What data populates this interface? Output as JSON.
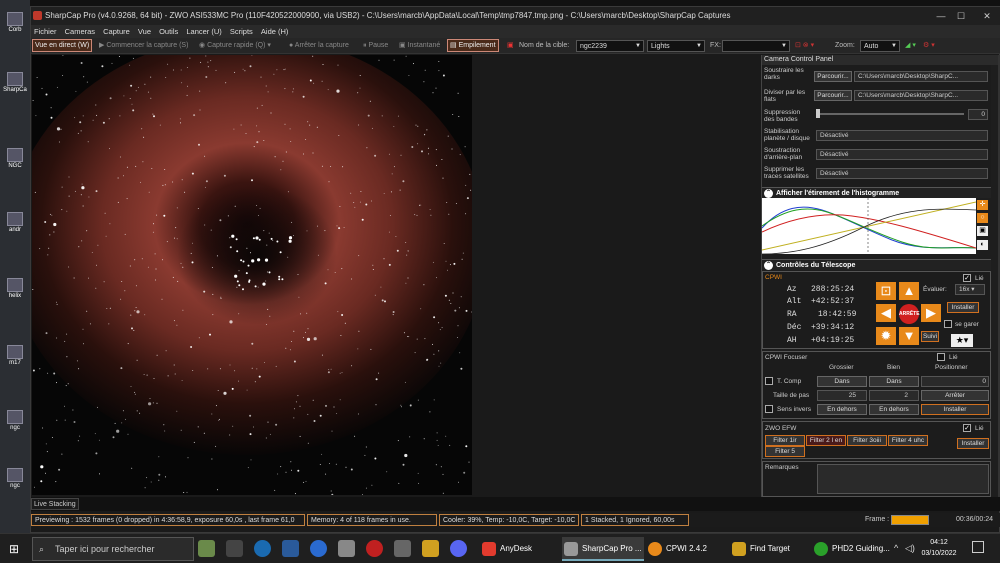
{
  "desktop": {
    "icons": [
      "Corb",
      "SharpCa",
      "NGC",
      "ngc2",
      "andr",
      "M1",
      "helix",
      "m17",
      "ngc",
      "ngc"
    ]
  },
  "window": {
    "title": "SharpCap Pro (v4.0.9268, 64 bit) - ZWO ASI533MC Pro (110F420522000900, via USB2) - C:\\Users\\marcb\\AppData\\Local\\Temp\\tmp7847.tmp.png - C:\\Users\\marcb\\Desktop\\SharpCap Captures",
    "min": "—",
    "max": "☐",
    "close": "✕"
  },
  "menu": [
    "Fichier",
    "Cameras",
    "Capture",
    "Vue",
    "Outils",
    "Lancer (U)",
    "Scripts",
    "Aide (H)"
  ],
  "toolbar": {
    "live": "Vue en direct (W)",
    "start": "Commencer la capture (S)",
    "quick": "Capture rapide (Q)",
    "stop": "Arrêter la capture",
    "pause": "Pause",
    "snapshot": "Instantané",
    "stack": "Empilement",
    "target_label": "Nom de la cible:",
    "target": "ngc2239",
    "frametype": "Lights",
    "fx_label": "FX:",
    "fx": "",
    "zoom_label": "Zoom:",
    "zoom": "Auto"
  },
  "panel": {
    "title": "Camera Control Panel",
    "dark_label": "Soustraire les darks",
    "browse": "Parcourir...",
    "dark_path": "C:\\Users\\marcb\\Desktop\\SharpC...",
    "flat_label": "Diviser par les flats",
    "flat_path": "C:\\Users\\marcb\\Desktop\\SharpC...",
    "banding_label": "Suppression des bandes",
    "banding_value": "0",
    "stab_label": "Stabilisation planète / disque",
    "stab_value": "Désactivé",
    "bg_label": "Soustraction d'arrière-plan",
    "bg_value": "Désactivé",
    "sat_label": "Supprimer les traces satellites",
    "sat_value": "Désactivé",
    "hist_title": "Afficher l'étirement de l'histogramme",
    "tel_title": "Contrôles du Télescope",
    "cpwi": "CPWI",
    "lie": "Lié",
    "az_l": "Az",
    "az": "288:25:24",
    "alt_l": "Alt",
    "alt": "+42:52:37",
    "ra_l": "RA",
    "ra": "18:42:59",
    "dec_l": "Déc",
    "dec": "+39:34:12",
    "ah_l": "AH",
    "ah": "+04:19:25",
    "evaluate": "Évaluer:",
    "rate": "16x",
    "install": "Installer",
    "park": "se garer",
    "stop": "ARRÊTE",
    "follow": "Suivi",
    "foc_title": "CPWI Focuser",
    "coarse": "Grossier",
    "fine": "Bien",
    "position": "Positionner",
    "tcomp": "T. Comp",
    "in": "Dans",
    "pos_val": "0",
    "step": "Taille de pas",
    "coarse_step": "25",
    "fine_step": "2",
    "stopbtn": "Arrêter",
    "reverse": "Sens invers",
    "out": "En dehors",
    "efw": "ZWO EFW",
    "filters": [
      "Filter 1ir",
      "Filter 2 l en",
      "Filter 3oiii",
      "Filter 4 uhc",
      "Filter 5"
    ],
    "notes": "Remarques"
  },
  "status": {
    "live_stacking": "Live Stacking",
    "preview": "Previewing : 1532 frames (0 dropped) in 4:36:58,9, exposure 60,0s , last frame 61,0",
    "memory": "Memory: 4 of 118 frames in use.",
    "cooler": "Cooler: 39%, Temp: -10,0C, Target: -10,0C",
    "stacked": "1 Stacked, 1 Ignored, 60,00s",
    "frame_label": "Frame :",
    "time": "00:36/00:24",
    "frame_progress": 1.0
  },
  "taskbar": {
    "search": "Taper ici pour rechercher",
    "apps": [
      "AnyDesk",
      "SharpCap Pro ...",
      "CPWI 2.4.2",
      "Find Target",
      "PHD2 Guiding..."
    ],
    "time": "04:12",
    "date": "03/10/2022"
  },
  "colors": {
    "accent": "#e8891a",
    "stop": "#d12020"
  }
}
